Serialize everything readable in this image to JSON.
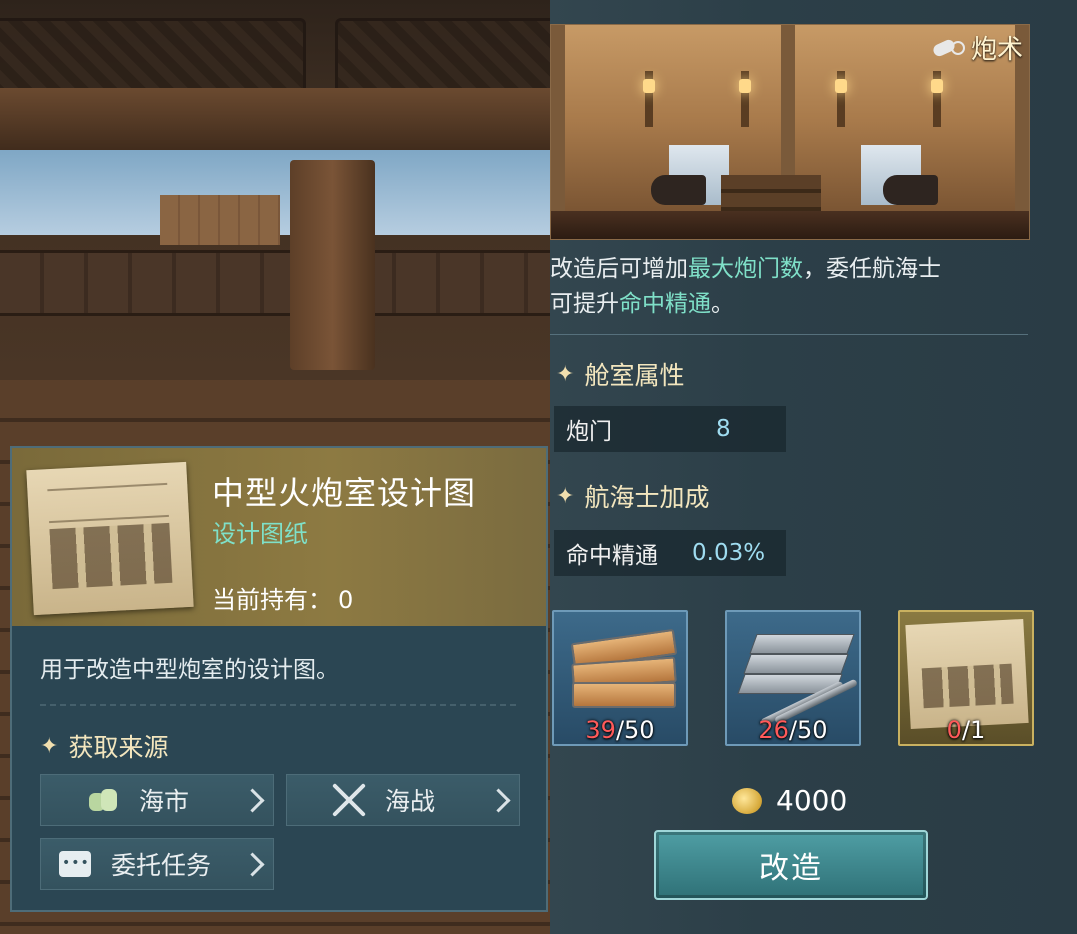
{
  "preview": {
    "skill_icon": "cannon-skill-icon",
    "skill_label": "炮术"
  },
  "description": {
    "part1": "改造后可增加",
    "highlight1": "最大炮门数",
    "part2": "，委任航海士",
    "part3": "可提升",
    "highlight2": "命中精通",
    "part4": "。"
  },
  "cabin_attributes": {
    "title": "舱室属性",
    "rows": [
      {
        "label": "炮门",
        "value": "8"
      }
    ]
  },
  "navigator_bonus": {
    "title": "航海士加成",
    "rows": [
      {
        "label": "命中精通",
        "value": "0.03%"
      }
    ]
  },
  "materials": [
    {
      "icon": "wood-planks-icon",
      "have": "39",
      "need": "/50"
    },
    {
      "icon": "iron-plates-icon",
      "have": "26",
      "need": "/50"
    },
    {
      "icon": "blueprint-icon",
      "have": "0",
      "need": "/1"
    }
  ],
  "cost": {
    "icon": "gold-coin-icon",
    "amount": "4000"
  },
  "action_button": "改造",
  "item_card": {
    "name": "中型火炮室设计图",
    "type": "设计图纸",
    "owned_label": "当前持有：",
    "owned_value": "0",
    "description": "用于改造中型炮室的设计图。",
    "sources_title": "获取来源",
    "sources": [
      {
        "icon": "money-bag-icon",
        "label": "海市"
      },
      {
        "icon": "crossed-swords-icon",
        "label": "海战"
      },
      {
        "icon": "chat-bubble-icon",
        "label": "委托任务"
      }
    ]
  },
  "colors": {
    "highlight": "#7fe0c8",
    "section_title": "#f3e6be",
    "shortage": "#ff5a5a",
    "value": "#9fdcf0"
  }
}
